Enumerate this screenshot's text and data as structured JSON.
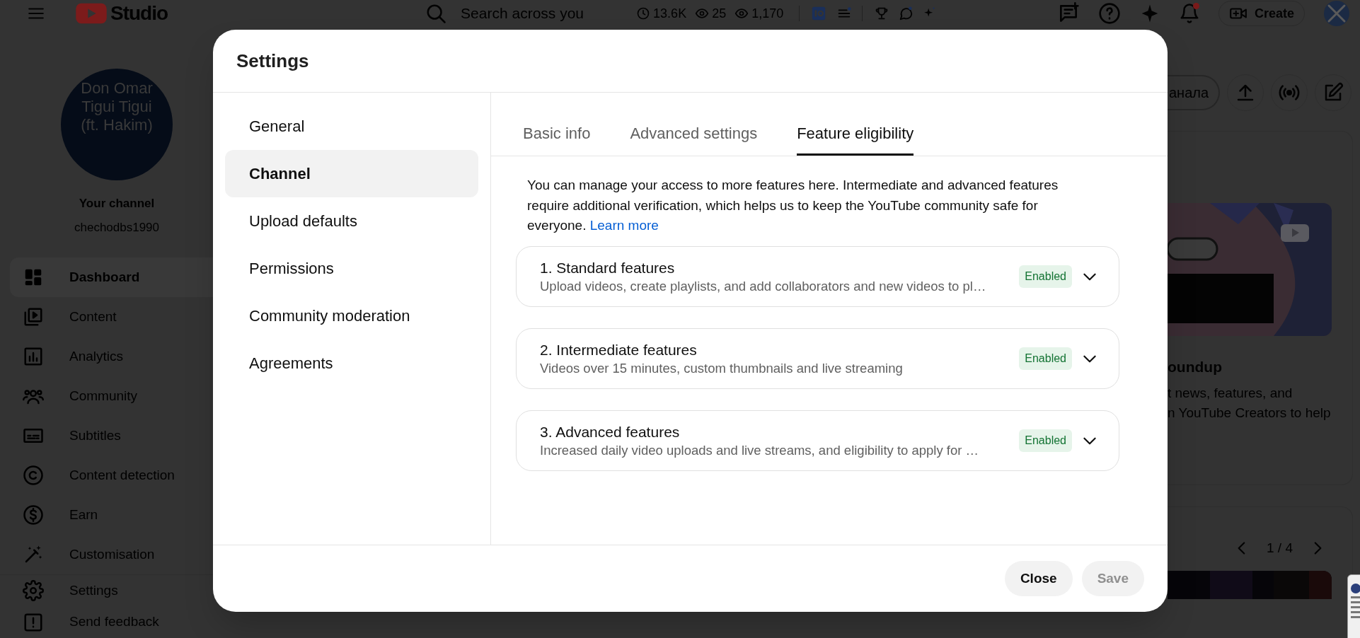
{
  "top_bar": {
    "logo_text": "Studio",
    "search_placeholder": "Search across you",
    "stats": [
      {
        "kind": "clock",
        "value": "13.6K"
      },
      {
        "kind": "eye",
        "value": "25"
      },
      {
        "kind": "eye",
        "value": "1,170"
      }
    ],
    "create_label": "Create",
    "notification_dot": true
  },
  "channel": {
    "avatar_lines": [
      "Don Omar",
      "Tigui Tigui",
      "(ft. Hakim)"
    ],
    "title": "Your channel",
    "handle": "chechodbs1990"
  },
  "sidebar": {
    "items": [
      {
        "label": "Dashboard",
        "kind": "dashboard",
        "selected": true
      },
      {
        "label": "Content",
        "kind": "content",
        "selected": false
      },
      {
        "label": "Analytics",
        "kind": "analytics",
        "selected": false
      },
      {
        "label": "Community",
        "kind": "community",
        "selected": false
      },
      {
        "label": "Subtitles",
        "kind": "subtitles",
        "selected": false
      },
      {
        "label": "Content detection",
        "kind": "copyright",
        "selected": false
      },
      {
        "label": "Earn",
        "kind": "earn",
        "selected": false
      },
      {
        "label": "Customisation",
        "kind": "wand",
        "selected": false
      }
    ],
    "bottom_items": [
      {
        "label": "Settings",
        "kind": "settings"
      },
      {
        "label": "Send feedback",
        "kind": "feedback"
      }
    ]
  },
  "background": {
    "chip_label": "анала",
    "card_title": "oundup",
    "card_lines": [
      "t news, features, and",
      "n YouTube Creators to help"
    ],
    "pager": "1 / 4"
  },
  "dialog": {
    "title": "Settings",
    "nav": [
      {
        "label": "General",
        "selected": false
      },
      {
        "label": "Channel",
        "selected": true
      },
      {
        "label": "Upload defaults",
        "selected": false
      },
      {
        "label": "Permissions",
        "selected": false
      },
      {
        "label": "Community moderation",
        "selected": false
      },
      {
        "label": "Agreements",
        "selected": false
      }
    ],
    "tabs": [
      {
        "label": "Basic info",
        "selected": false
      },
      {
        "label": "Advanced settings",
        "selected": false
      },
      {
        "label": "Feature eligibility",
        "selected": true
      }
    ],
    "intro": "You can manage your access to more features here. Intermediate and advanced features require additional verification, which helps us to keep the YouTube community safe for everyone.",
    "learn_more": "Learn more",
    "features": [
      {
        "title": "1. Standard features",
        "description": "Upload videos, create playlists, and add collaborators and new videos to pl…",
        "status": "Enabled",
        "expanded": false
      },
      {
        "title": "2. Intermediate features",
        "description": "Videos over 15 minutes, custom thumbnails and live streaming",
        "status": "Enabled",
        "expanded": false
      },
      {
        "title": "3. Advanced features",
        "description": "Increased daily video uploads and live streams, and eligibility to apply for …",
        "status": "Enabled",
        "expanded": false
      }
    ],
    "buttons": [
      {
        "label": "Close",
        "disabled": false
      },
      {
        "label": "Save",
        "disabled": true
      }
    ]
  }
}
